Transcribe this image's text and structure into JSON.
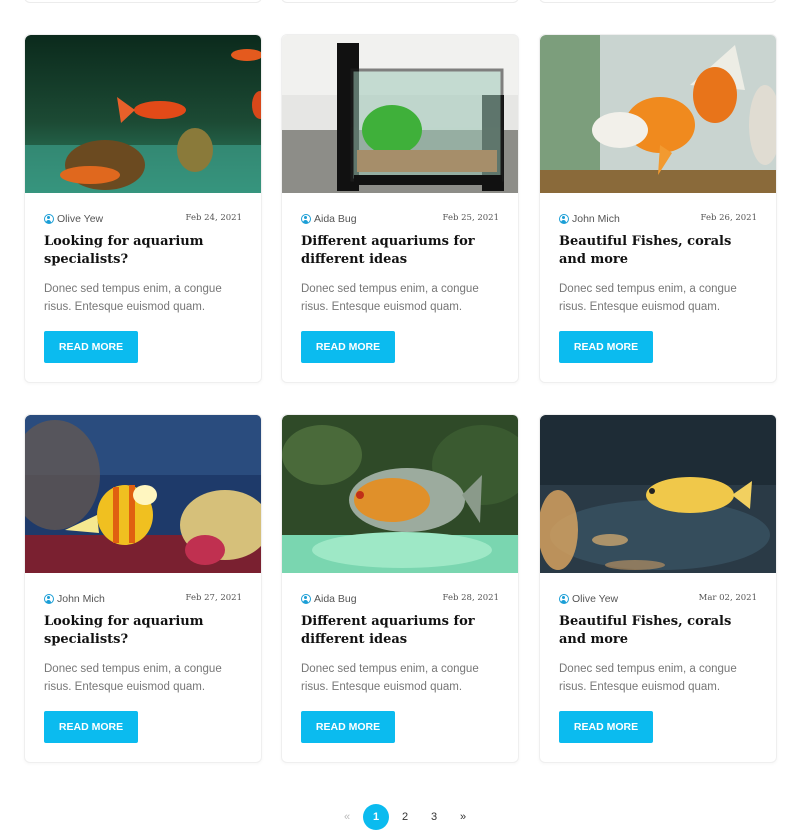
{
  "posts": [
    {
      "author": "Olive Yew",
      "date": "Feb 24, 2021",
      "title": "Looking for aquarium specialists?",
      "excerpt": "Donec sed tempus enim, a congue risus. Entesque euismod quam.",
      "button": "READ MORE",
      "image": "goldfish-tank-image"
    },
    {
      "author": "Aida Bug",
      "date": "Feb 25, 2021",
      "title": "Different aquariums for different ideas",
      "excerpt": "Donec sed tempus enim, a congue risus. Entesque euismod quam.",
      "button": "READ MORE",
      "image": "small-aquarium-image"
    },
    {
      "author": "John Mich",
      "date": "Feb 26, 2021",
      "title": "Beautiful Fishes, corals and more",
      "excerpt": "Donec sed tempus enim, a congue risus. Entesque euismod quam.",
      "button": "READ MORE",
      "image": "goldfish-closeup-image"
    },
    {
      "author": "John Mich",
      "date": "Feb 27, 2021",
      "title": "Looking for aquarium specialists?",
      "excerpt": "Donec sed tempus enim, a congue risus. Entesque euismod quam.",
      "button": "READ MORE",
      "image": "butterflyfish-coral-image"
    },
    {
      "author": "Aida Bug",
      "date": "Feb 28, 2021",
      "title": "Different aquariums for different ideas",
      "excerpt": "Donec sed tempus enim, a congue risus. Entesque euismod quam.",
      "button": "READ MORE",
      "image": "oscar-fish-image"
    },
    {
      "author": "Olive Yew",
      "date": "Mar 02, 2021",
      "title": "Beautiful Fishes, corals and more",
      "excerpt": "Donec sed tempus enim, a congue risus. Entesque euismod quam.",
      "button": "READ MORE",
      "image": "yellow-cichlid-image"
    }
  ],
  "pagination": {
    "prev": "«",
    "pages": [
      "1",
      "2",
      "3"
    ],
    "current": "1",
    "next": "»"
  },
  "colors": {
    "accent": "#0bbbef",
    "author_icon": "#1a9ed6"
  }
}
